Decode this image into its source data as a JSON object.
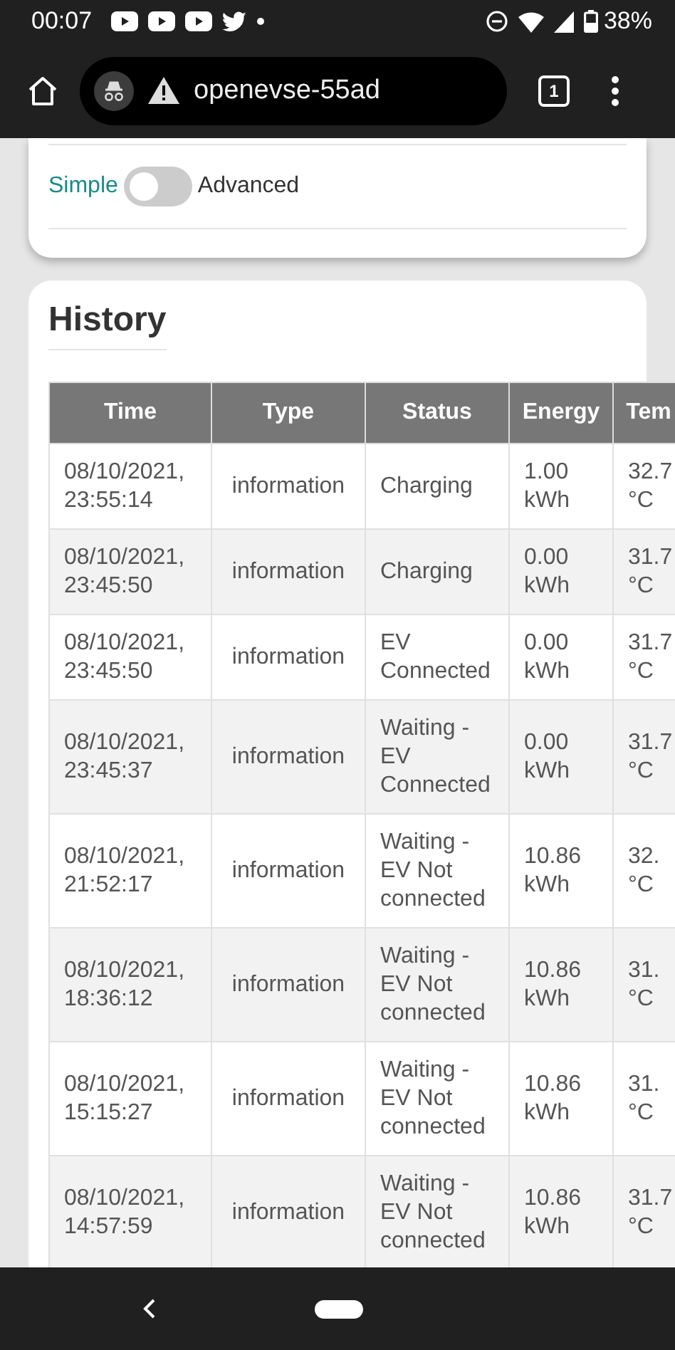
{
  "status_bar": {
    "time": "00:07",
    "battery": "38%"
  },
  "browser": {
    "url": "openevse-55ad",
    "tab_count": "1"
  },
  "mode_toggle": {
    "options": [
      {
        "label": "Simple",
        "selected": true
      },
      {
        "label": "Advanced",
        "selected": false
      }
    ]
  },
  "history": {
    "title": "History",
    "table": {
      "columns": [
        "Time",
        "Type",
        "Status",
        "Energy",
        "Tem"
      ],
      "rows": [
        [
          "08/10/2021, 23:55:14",
          "information",
          "Charging",
          "1.00 kWh",
          "32.7 °C"
        ],
        [
          "08/10/2021, 23:45:50",
          "information",
          "Charging",
          "0.00 kWh",
          "31.7 °C"
        ],
        [
          "08/10/2021, 23:45:50",
          "information",
          "EV Connected",
          "0.00 kWh",
          "31.7 °C"
        ],
        [
          "08/10/2021, 23:45:37",
          "information",
          "Waiting - EV Connected",
          "0.00 kWh",
          "31.7 °C"
        ],
        [
          "08/10/2021, 21:52:17",
          "information",
          "Waiting - EV Not connected",
          "10.86 kWh",
          "32. °C"
        ],
        [
          "08/10/2021, 18:36:12",
          "information",
          "Waiting - EV Not connected",
          "10.86 kWh",
          "31. °C"
        ],
        [
          "08/10/2021, 15:15:27",
          "information",
          "Waiting - EV Not connected",
          "10.86 kWh",
          "31. °C"
        ],
        [
          "08/10/2021, 14:57:59",
          "information",
          "Waiting - EV Not connected",
          "10.86 kWh",
          "31.7 °C"
        ]
      ]
    }
  }
}
